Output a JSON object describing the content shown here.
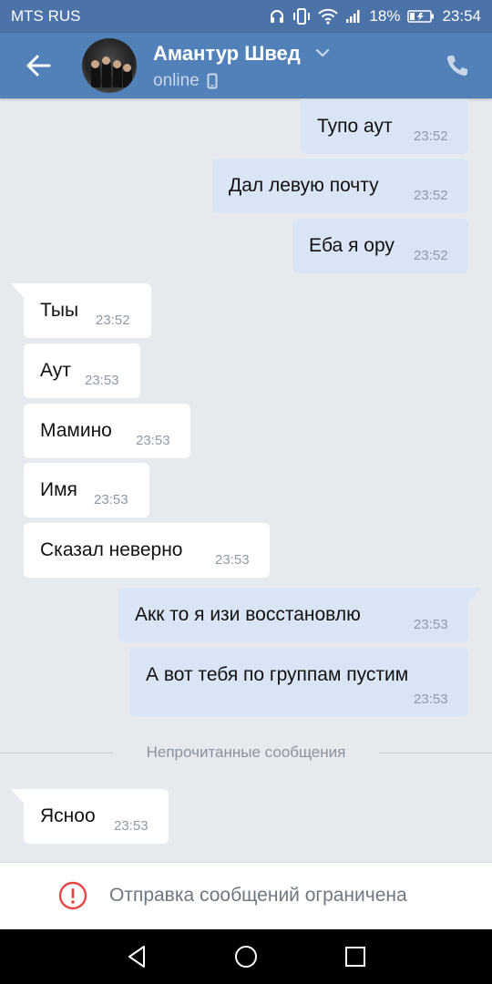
{
  "status_bar": {
    "carrier": "MTS RUS",
    "battery": "18%",
    "time": "23:54"
  },
  "header": {
    "contact_name": "Амантур Швед",
    "status": "online",
    "icons": [
      "back-arrow-icon",
      "avatar",
      "chevron-down-icon",
      "phone-icon",
      "call-icon"
    ]
  },
  "messages": [
    {
      "dir": "out",
      "text": "Тупо аут",
      "time": "23:52"
    },
    {
      "dir": "out",
      "text": "Дал левую почту",
      "time": "23:52"
    },
    {
      "dir": "out",
      "text": "Еба я ору",
      "time": "23:52"
    },
    {
      "dir": "in",
      "text": "Тыы",
      "time": "23:52"
    },
    {
      "dir": "in",
      "text": "Аут",
      "time": "23:53"
    },
    {
      "dir": "in",
      "text": "Мамино",
      "time": "23:53"
    },
    {
      "dir": "in",
      "text": "Имя",
      "time": "23:53"
    },
    {
      "dir": "in",
      "text": "Сказал неверно",
      "time": "23:53"
    },
    {
      "dir": "out",
      "text": "Акк то я изи восстановлю",
      "time": "23:53"
    },
    {
      "dir": "out",
      "text": "А вот тебя по группам пустим",
      "time": "23:53"
    },
    {
      "dir": "in",
      "text": "Ясноо",
      "time": "23:53"
    }
  ],
  "unread_divider": "Непрочитанные сообщения",
  "bottom_bar": {
    "notice": "Отправка сообщений ограничена"
  },
  "colors": {
    "header": "#5181b8",
    "status_bar": "#4b73a8",
    "outgoing_bubble": "#d9e5f5",
    "incoming_bubble": "#ffffff",
    "warning": "#e64646"
  }
}
